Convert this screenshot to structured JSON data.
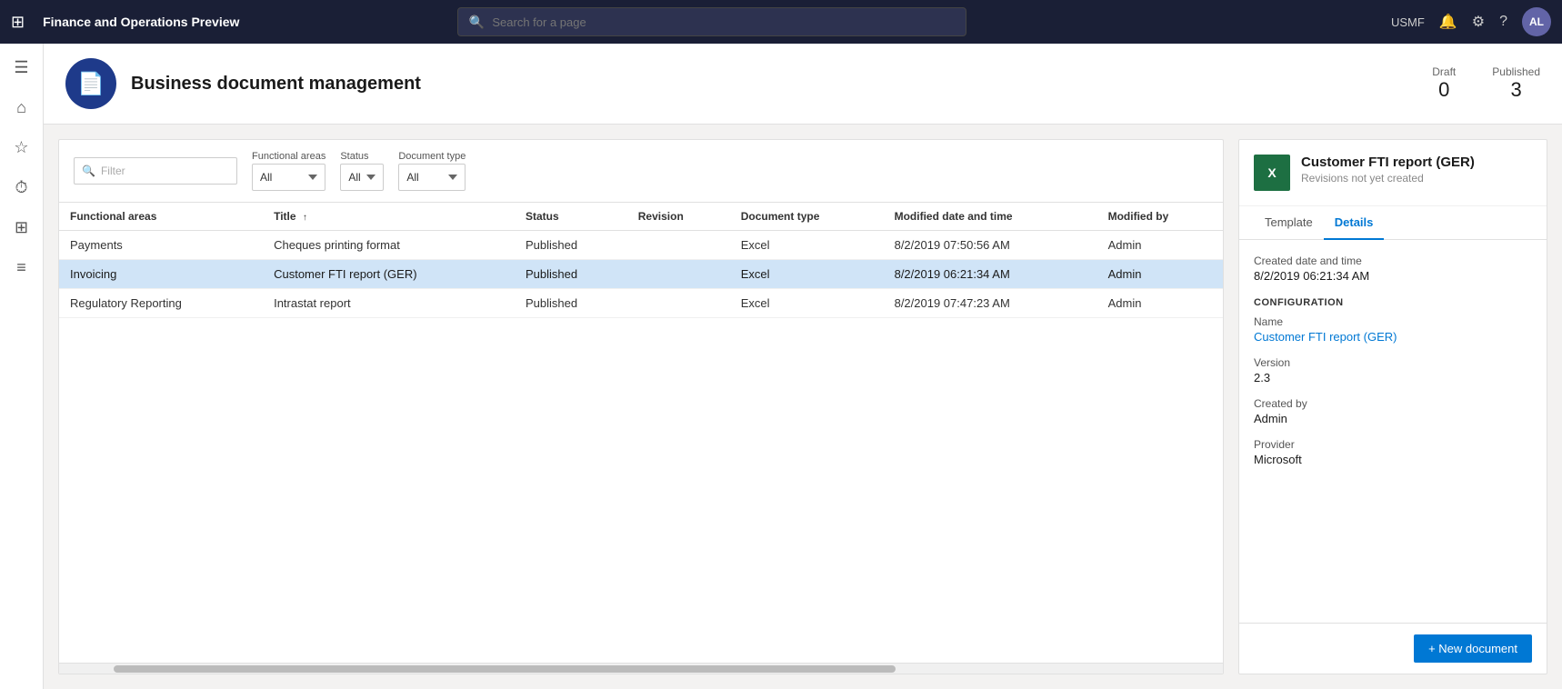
{
  "topNav": {
    "appTitle": "Finance and Operations Preview",
    "searchPlaceholder": "Search for a page",
    "userInitials": "AL",
    "userRegion": "USMF"
  },
  "pageHeader": {
    "title": "Business document management",
    "icon": "📄",
    "draftLabel": "Draft",
    "draftCount": "0",
    "publishedLabel": "Published",
    "publishedCount": "3"
  },
  "filters": {
    "filterPlaceholder": "Filter",
    "functionalAreasLabel": "Functional areas",
    "functionalAreasOptions": [
      "All"
    ],
    "functionalAreasValue": "All",
    "statusLabel": "Status",
    "statusOptions": [
      "All"
    ],
    "statusValue": "All",
    "documentTypeLabel": "Document type",
    "documentTypeOptions": [
      "All"
    ],
    "documentTypeValue": "All"
  },
  "tableHeaders": {
    "functionalAreas": "Functional areas",
    "title": "Title",
    "titleSort": "↑",
    "status": "Status",
    "revision": "Revision",
    "documentType": "Document type",
    "modifiedDateTime": "Modified date and time",
    "modifiedBy": "Modified by"
  },
  "tableRows": [
    {
      "functionalAreas": "Payments",
      "title": "Cheques printing format",
      "status": "Published",
      "revision": "",
      "documentType": "Excel",
      "modifiedDateTime": "8/2/2019 07:50:56 AM",
      "modifiedBy": "Admin",
      "selected": false
    },
    {
      "functionalAreas": "Invoicing",
      "title": "Customer FTI report (GER)",
      "status": "Published",
      "revision": "",
      "documentType": "Excel",
      "modifiedDateTime": "8/2/2019 06:21:34 AM",
      "modifiedBy": "Admin",
      "selected": true
    },
    {
      "functionalAreas": "Regulatory Reporting",
      "title": "Intrastat report",
      "status": "Published",
      "revision": "",
      "documentType": "Excel",
      "modifiedDateTime": "8/2/2019 07:47:23 AM",
      "modifiedBy": "Admin",
      "selected": false
    }
  ],
  "detailPanel": {
    "title": "Customer FTI report (GER)",
    "subtitle": "Revisions not yet created",
    "excelLabel": "X",
    "tabs": {
      "template": "Template",
      "details": "Details"
    },
    "activeTab": "Details",
    "createdDateTimeLabel": "Created date and time",
    "createdDateTimeValue": "8/2/2019 06:21:34 AM",
    "configurationSectionTitle": "CONFIGURATION",
    "nameLabel": "Name",
    "nameValue": "Customer FTI report (GER)",
    "versionLabel": "Version",
    "versionValue": "2.3",
    "createdByLabel": "Created by",
    "createdByValue": "Admin",
    "providerLabel": "Provider",
    "providerValue": "Microsoft",
    "newDocumentButton": "+ New document"
  },
  "sidebarIcons": [
    {
      "name": "hamburger-icon",
      "symbol": "☰"
    },
    {
      "name": "home-icon",
      "symbol": "⌂"
    },
    {
      "name": "star-icon",
      "symbol": "★"
    },
    {
      "name": "history-icon",
      "symbol": "⏱"
    },
    {
      "name": "table-icon",
      "symbol": "⊞"
    },
    {
      "name": "list-icon",
      "symbol": "≡"
    }
  ]
}
